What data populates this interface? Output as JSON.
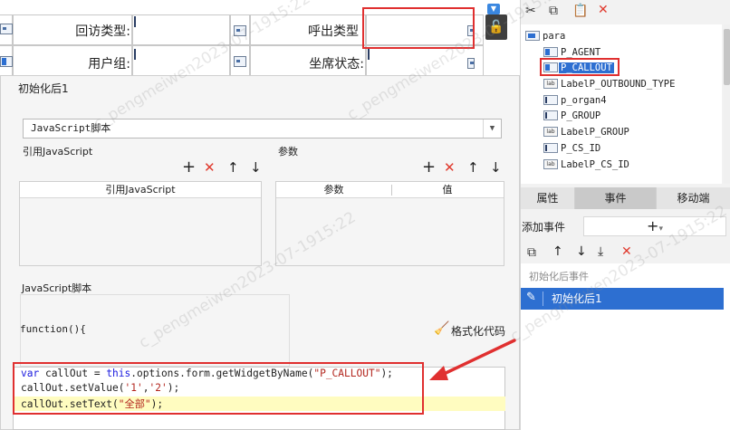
{
  "designer": {
    "row1": {
      "label1": "回访类型:",
      "label2": "呼出类型"
    },
    "row2": {
      "label1": "用户组:",
      "label2": "坐席状态:"
    },
    "lock_glyph": "🔓"
  },
  "dialog": {
    "title": "初始化后1",
    "script_type": "JavaScript脚本",
    "ref_section_label": "引用JavaScript",
    "param_section_label": "参数",
    "ref_table_header": "引用JavaScript",
    "param_table_headers": [
      "参数",
      "值"
    ],
    "js_section_label": "JavaScript脚本",
    "function_header": "function(){",
    "format_label": "格式化代码",
    "code": {
      "line1_kw": "var",
      "line1_a": " callOut = ",
      "line1_this": "this",
      "line1_b": ".options.form.getWidgetByName(",
      "line1_str": "\"P_CALLOUT\"",
      "line1_c": ");",
      "line2_a": "callOut.setValue(",
      "line2_s1": "'1'",
      "line2_comma": ",",
      "line2_s2": "'2'",
      "line2_c": ");",
      "line3_a": "callOut.setText(",
      "line3_str": "\"全部\"",
      "line3_c": ");"
    }
  },
  "right_panel": {
    "tree": {
      "root": "para",
      "items": [
        "P_AGENT",
        "P_CALLOUT",
        "LabelP_OUTBOUND_TYPE",
        "p_organ4",
        "P_GROUP",
        "LabelP_GROUP",
        "P_CS_ID",
        "LabelP_CS_ID"
      ],
      "lab_tag": "lab"
    },
    "tabs": [
      "属性",
      "事件",
      "移动端"
    ],
    "active_tab": "事件",
    "add_event_label": "添加事件",
    "add_event_plus": "+",
    "add_event_caret": "▾",
    "event_group": "初始化后事件",
    "event_item": "初始化后1"
  },
  "watermark": "c_pengmeiwen2023-07-1915:22",
  "colors": {
    "accent": "#2d6fd1",
    "highlight_red": "#e03030",
    "code_highlight": "#fffcc0",
    "keyword": "#1a1adf",
    "string": "#b3261e"
  }
}
